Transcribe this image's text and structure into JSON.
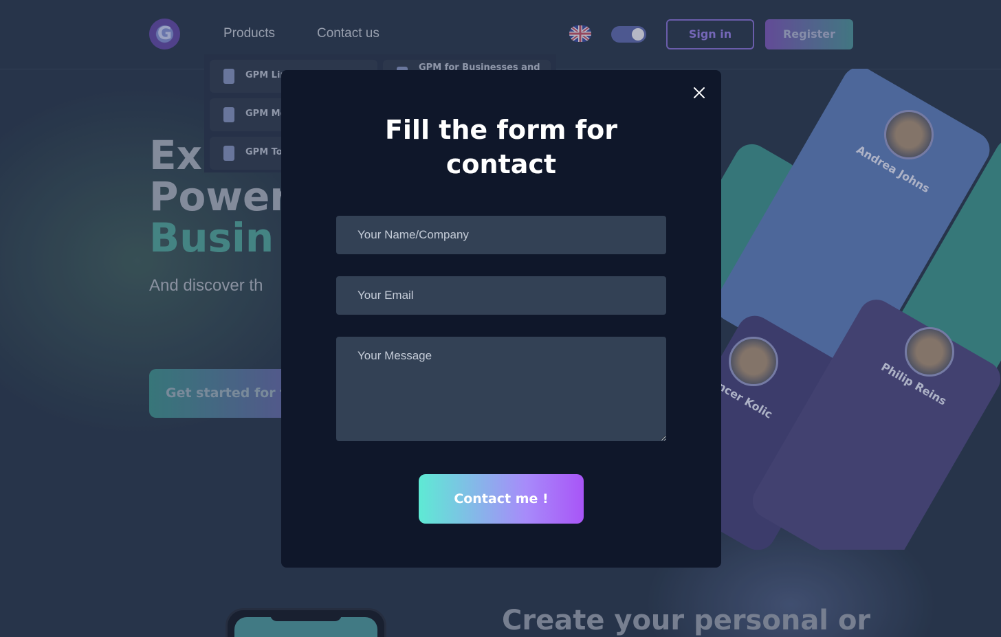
{
  "nav": {
    "logo_letter": "G",
    "products_label": "Products",
    "contact_label": "Contact us",
    "language_flag": "uk-flag-icon",
    "theme_toggle": "moon-cloud-toggle-icon",
    "signin_label": "Sign in",
    "register_label": "Register"
  },
  "dropdown": {
    "items": [
      {
        "label": "GPM Lin",
        "icon": "link-icon"
      },
      {
        "label": "GPM Mo",
        "icon": "phone-icon"
      },
      {
        "label": "GPM To",
        "icon": "g-icon"
      },
      {
        "label": "GPM for Businesses and",
        "icon": "business-icon"
      }
    ]
  },
  "hero": {
    "title_line1": "Ex",
    "title_line2": "Power",
    "title_line3": "Busin",
    "subtitle": "And discover th",
    "cta_label": "Get started for fr"
  },
  "showcase": {
    "cards": [
      {
        "name": "Andrea Johns"
      },
      {
        "name": "Philip Reins"
      },
      {
        "name": "ncer Kolic"
      }
    ]
  },
  "bottom": {
    "title": "Create your personal or"
  },
  "modal": {
    "title": "Fill the form for contact",
    "name_placeholder": "Your Name/Company",
    "email_placeholder": "Your Email",
    "message_placeholder": "Your Message",
    "submit_label": "Contact me !"
  },
  "colors": {
    "modal_bg": "#0f172a",
    "field_bg": "#334155",
    "button_gradient_start": "#5eead4",
    "button_gradient_end": "#a855f7"
  }
}
